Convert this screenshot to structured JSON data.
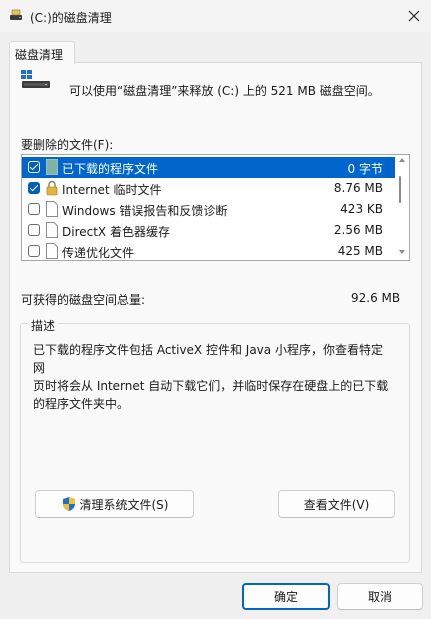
{
  "window": {
    "title": "(C:)的磁盘清理",
    "tab": "磁盘清理"
  },
  "info": {
    "text": "可以使用“磁盘清理”来释放 (C:) 上的 521 MB 磁盘空间。"
  },
  "list": {
    "label": "要删除的文件(F):",
    "items": [
      {
        "name": "已下载的程序文件",
        "size": "0 字节",
        "checked": true,
        "selected": true,
        "icon": "folder-teal-icon"
      },
      {
        "name": "Internet 临时文件",
        "size": "8.76 MB",
        "checked": true,
        "selected": false,
        "icon": "lock-icon"
      },
      {
        "name": "Windows 错误报告和反馈诊断",
        "size": "423 KB",
        "checked": false,
        "selected": false,
        "icon": "file-icon"
      },
      {
        "name": "DirectX 着色器缓存",
        "size": "2.56 MB",
        "checked": false,
        "selected": false,
        "icon": "file-icon"
      },
      {
        "name": "传递优化文件",
        "size": "425 MB",
        "checked": false,
        "selected": false,
        "icon": "file-icon"
      }
    ]
  },
  "summary": {
    "label": "可获得的磁盘空间总量:",
    "value": "92.6 MB"
  },
  "description": {
    "title": "描述",
    "lines": [
      "已下载的程序文件包括 ActiveX 控件和 Java 小程序，你查看特定网",
      "页时将会从 Internet 自动下载它们，并临时保存在硬盘上的已下载",
      "的程序文件夹中。"
    ]
  },
  "buttons": {
    "clean_system": "清理系统文件(S)",
    "view_files": "查看文件(V)",
    "ok": "确定",
    "cancel": "取消"
  },
  "colors": {
    "selection": "#0066cc",
    "accent": "#005fb8"
  }
}
